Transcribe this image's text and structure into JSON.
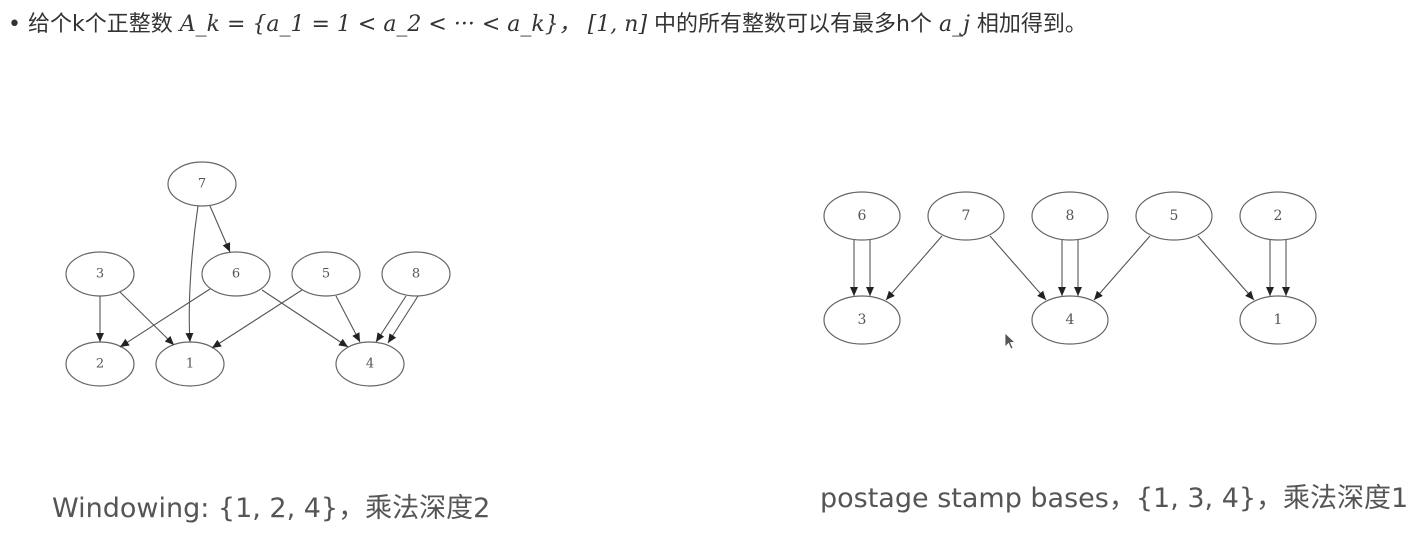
{
  "bullet": {
    "symbol": "•",
    "prefix": "给个k个正整数",
    "math_set": "A_k = {a_1 = 1 < a_2 < ··· < a_k}，",
    "range": "[1, n]",
    "suffix": "中的所有整数可以有最多h个",
    "aj": "a_j",
    "end": "相加得到。"
  },
  "diagrams": [
    {
      "caption": "Windowing: {1, 2, 4}，乘法深度2",
      "nodes": [
        "7",
        "3",
        "6",
        "5",
        "8",
        "2",
        "1",
        "4"
      ],
      "edges": [
        [
          "7",
          "6"
        ],
        [
          "7",
          "1"
        ],
        [
          "3",
          "2"
        ],
        [
          "3",
          "1"
        ],
        [
          "6",
          "2"
        ],
        [
          "6",
          "4"
        ],
        [
          "5",
          "1"
        ],
        [
          "5",
          "4"
        ],
        [
          "8",
          "4"
        ],
        [
          "8",
          "4"
        ]
      ]
    },
    {
      "caption": "postage stamp bases，{1, 3, 4}，乘法深度1",
      "nodes": [
        "6",
        "7",
        "8",
        "5",
        "2",
        "3",
        "4",
        "1"
      ],
      "edges": [
        [
          "6",
          "3"
        ],
        [
          "6",
          "3"
        ],
        [
          "7",
          "3"
        ],
        [
          "7",
          "4"
        ],
        [
          "8",
          "4"
        ],
        [
          "8",
          "4"
        ],
        [
          "5",
          "4"
        ],
        [
          "5",
          "1"
        ],
        [
          "2",
          "1"
        ],
        [
          "2",
          "1"
        ]
      ]
    }
  ]
}
